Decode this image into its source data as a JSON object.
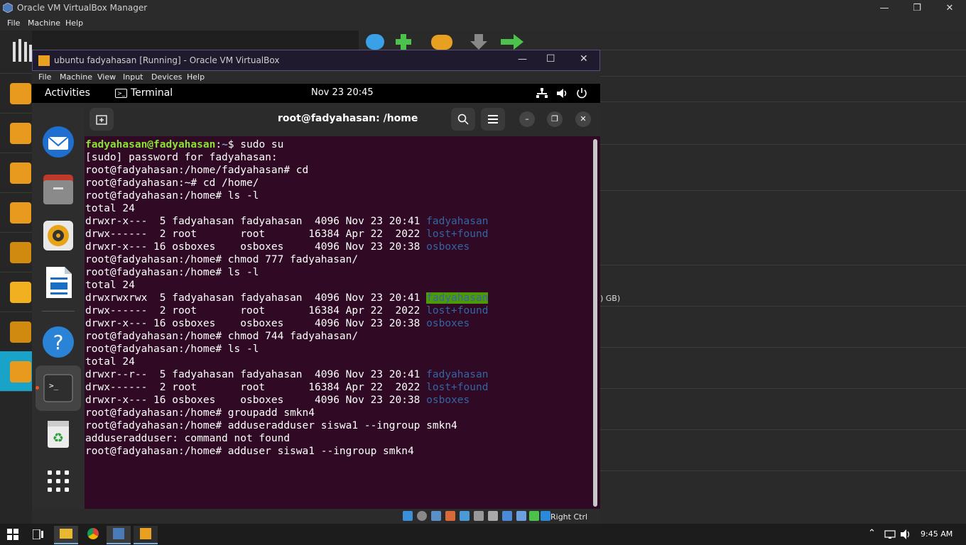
{
  "manager": {
    "title": "Oracle VM VirtualBox Manager",
    "menu": [
      "File",
      "Machine",
      "Help"
    ],
    "tools_label": "Tools",
    "detail_fragment": ") GB)"
  },
  "vm_window": {
    "title": "ubuntu fadyahasan [Running] - Oracle VM VirtualBox",
    "menu": [
      "File",
      "Machine",
      "View",
      "Input",
      "Devices",
      "Help"
    ],
    "host_key": "Right Ctrl"
  },
  "gnome": {
    "activities": "Activities",
    "app_name": "Terminal",
    "clock": "Nov 23  20:45"
  },
  "terminal": {
    "title": "root@fadyahasan: /home",
    "lines": [
      {
        "user": "fadyahasan@fadyahasan",
        "sep": ":",
        "path": "~",
        "cmd": "$ sudo su"
      },
      {
        "text": "[sudo] password for fadyahasan:"
      },
      {
        "text": "root@fadyahasan:/home/fadyahasan# cd"
      },
      {
        "text": "root@fadyahasan:~# cd /home/"
      },
      {
        "text": "root@fadyahasan:/home# ls -l"
      },
      {
        "text": "total 24"
      },
      {
        "text": "drwxr-x---  5 fadyahasan fadyahasan  4096 Nov 23 20:41 ",
        "dir": "fadyahasan"
      },
      {
        "text": "drwx------  2 root       root       16384 Apr 22  2022 ",
        "dir": "lost+found"
      },
      {
        "text": "drwxr-x--- 16 osboxes    osboxes     4096 Nov 23 20:38 ",
        "dir": "osboxes"
      },
      {
        "text": "root@fadyahasan:/home# chmod 777 fadyahasan/"
      },
      {
        "text": "root@fadyahasan:/home# ls -l"
      },
      {
        "text": "total 24"
      },
      {
        "text": "drwxrwxrwx  5 fadyahasan fadyahasan  4096 Nov 23 20:41 ",
        "dir": "fadyahasan",
        "highlight": true
      },
      {
        "text": "drwx------  2 root       root       16384 Apr 22  2022 ",
        "dir": "lost+found"
      },
      {
        "text": "drwxr-x--- 16 osboxes    osboxes     4096 Nov 23 20:38 ",
        "dir": "osboxes"
      },
      {
        "text": "root@fadyahasan:/home# chmod 744 fadyahasan/"
      },
      {
        "text": "root@fadyahasan:/home# ls -l"
      },
      {
        "text": "total 24"
      },
      {
        "text": "drwxr--r--  5 fadyahasan fadyahasan  4096 Nov 23 20:41 ",
        "dir": "fadyahasan"
      },
      {
        "text": "drwx------  2 root       root       16384 Apr 22  2022 ",
        "dir": "lost+found"
      },
      {
        "text": "drwxr-x--- 16 osboxes    osboxes     4096 Nov 23 20:38 ",
        "dir": "osboxes"
      },
      {
        "text": "root@fadyahasan:/home# groupadd smkn4"
      },
      {
        "text": "root@fadyahasan:/home# adduseradduser siswa1 --ingroup smkn4"
      },
      {
        "text": "adduseradduser: command not found"
      },
      {
        "text": "root@fadyahasan:/home# adduser siswa1 --ingroup smkn4"
      }
    ]
  },
  "taskbar": {
    "time": "9:45 AM"
  },
  "colors": {
    "terminal_bg": "#300a24",
    "prompt_green": "#8ae234",
    "dir_blue": "#3465a4",
    "highlight_green": "#4e9a06"
  }
}
